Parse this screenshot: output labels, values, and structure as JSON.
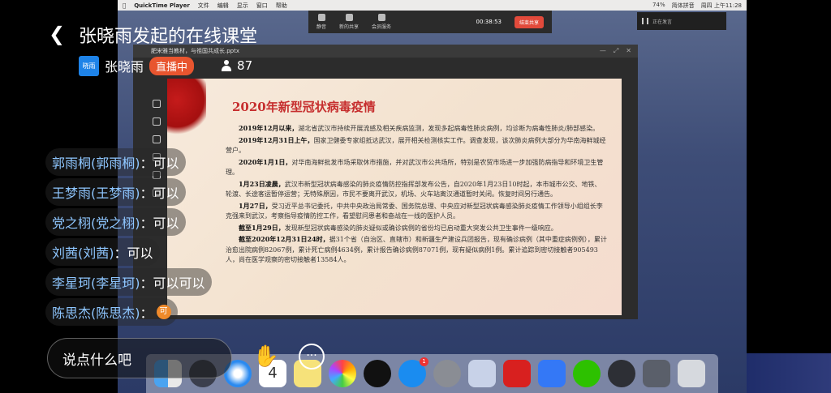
{
  "mac": {
    "app_name": "QuickTime Player",
    "menus": [
      "文件",
      "编辑",
      "显示",
      "窗口",
      "帮助"
    ],
    "status_right": [
      "74%",
      "简体拼音",
      "周四 上午11:28"
    ]
  },
  "meeting_bar": {
    "items": [
      "静音",
      "新的共享",
      "会员服务"
    ],
    "timer": "00:38:53",
    "end_label": "结束共享"
  },
  "speaking": {
    "label": "正在发言"
  },
  "ppt": {
    "window_title": "肥宋雅当教材，与祖国共成长.pptx",
    "slide_title": "2020年新型冠状病毒疫情",
    "paragraphs": [
      {
        "lead": "2019年12月以来，",
        "body": "湖北省武汉市持续开展流感及相关疾病监测，发现多起病毒性肺炎病例，均诊断为病毒性肺炎/肺部感染。"
      },
      {
        "lead": "2019年12月31日上午，",
        "body": "国家卫健委专家组抵达武汉，展开相关检测核实工作。调查发现，该次肺炎病例大部分为华南海鲜城经营户。"
      },
      {
        "lead": "2020年1月1日，",
        "body": "对华南海鲜批发市场采取休市措施，并对武汉市公共场所，特别是农贸市场进一步加强防病指导和环境卫生管理。"
      },
      {
        "lead": "1月23日凌晨，",
        "body": "武汉市新型冠状病毒感染的肺炎疫情防控指挥部发布公告，自2020年1月23日10时起，本市城市公交、地铁、轮渡、长途客运暂停运营；无特殊原因，市民不要离开武汉，机场、火车站离汉通道暂时关闭。恢复时间另行通告。"
      },
      {
        "lead": "1月27日，",
        "body": "受习近平总书记委托，中共中央政治局常委、国务院总理、中央应对新型冠状病毒感染肺炎疫情工作领导小组组长李克强来到武汉，考察指导疫情防控工作，看望慰问患者和奋战在一线的医护人员。"
      },
      {
        "lead": "截至1月29日，",
        "body": "发现新型冠状病毒感染的肺炎疑似或确诊病例的省份均已启动重大突发公共卫生事件一级响应。"
      },
      {
        "lead": "截至2020年12月31日24时，",
        "body": "据31个省（自治区、直辖市）和新疆生产建设兵团报告，现有确诊病例（其中重症病例例），累计治愈出院病例82067例，累计死亡病例4634例，累计报告确诊病例87071例，现有疑似病例1例。累计追踪到密切接触者905493人，尚在医学观察的密切接触者13584人。"
      }
    ]
  },
  "dock": {
    "calendar_day": "4",
    "appstore_badge": "1",
    "icons": [
      "finder-icon",
      "launchpad-icon",
      "safari-icon",
      "calendar-icon",
      "notes-icon",
      "photos-icon",
      "qq-icon",
      "appstore-icon",
      "system-preferences-icon",
      "preview-icon",
      "acrobat-icon",
      "feishu-icon",
      "wechat-icon",
      "quicktime-icon",
      "screen-icon",
      "trash-icon"
    ]
  },
  "live": {
    "title": "张晓雨发起的在线课堂",
    "host_avatar_text": "晓雨",
    "host_name": "张晓雨",
    "live_badge": "直播中",
    "viewer_count": "87"
  },
  "chat": [
    {
      "sender": "郭雨桐(郭雨桐)",
      "text": "可以"
    },
    {
      "sender": "王梦雨(王梦雨)",
      "text": "可以"
    },
    {
      "sender": "党之栩(党之栩)",
      "text": "可以"
    },
    {
      "sender": "刘茜(刘茜)",
      "text": "可以"
    },
    {
      "sender": "李星珂(李星珂)",
      "text": "可以可以"
    },
    {
      "sender": "陈思杰(陈思杰)",
      "text": "",
      "sticker": "可"
    }
  ],
  "comment": {
    "placeholder": "说点什么吧"
  },
  "colors": {
    "live_badge": "#e8552f",
    "sender": "#8ec6ff",
    "slide_title": "#c62e2e",
    "host_avatar": "#1e83e8"
  }
}
